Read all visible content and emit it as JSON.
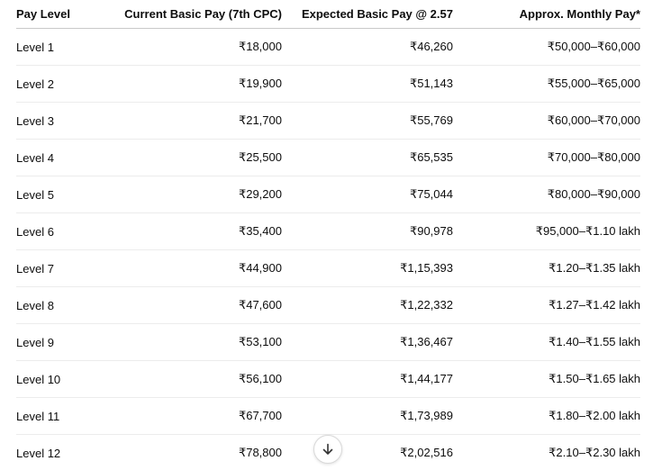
{
  "table": {
    "headers": [
      "Pay Level",
      "Current Basic Pay (7th CPC)",
      "Expected Basic Pay @ 2.57",
      "Approx. Monthly Pay*"
    ],
    "rows": [
      [
        "Level 1",
        "₹18,000",
        "₹46,260",
        "₹50,000–₹60,000"
      ],
      [
        "Level 2",
        "₹19,900",
        "₹51,143",
        "₹55,000–₹65,000"
      ],
      [
        "Level 3",
        "₹21,700",
        "₹55,769",
        "₹60,000–₹70,000"
      ],
      [
        "Level 4",
        "₹25,500",
        "₹65,535",
        "₹70,000–₹80,000"
      ],
      [
        "Level 5",
        "₹29,200",
        "₹75,044",
        "₹80,000–₹90,000"
      ],
      [
        "Level 6",
        "₹35,400",
        "₹90,978",
        "₹95,000–₹1.10 lakh"
      ],
      [
        "Level 7",
        "₹44,900",
        "₹1,15,393",
        "₹1.20–₹1.35 lakh"
      ],
      [
        "Level 8",
        "₹47,600",
        "₹1,22,332",
        "₹1.27–₹1.42 lakh"
      ],
      [
        "Level 9",
        "₹53,100",
        "₹1,36,467",
        "₹1.40–₹1.55 lakh"
      ],
      [
        "Level 10",
        "₹56,100",
        "₹1,44,177",
        "₹1.50–₹1.65 lakh"
      ],
      [
        "Level 11",
        "₹67,700",
        "₹1,73,989",
        "₹1.80–₹2.00 lakh"
      ],
      [
        "Level 12",
        "₹78,800",
        "₹2,02,516",
        "₹2.10–₹2.30 lakh"
      ]
    ]
  },
  "scroll_button": {
    "icon": "arrow-down-icon"
  }
}
